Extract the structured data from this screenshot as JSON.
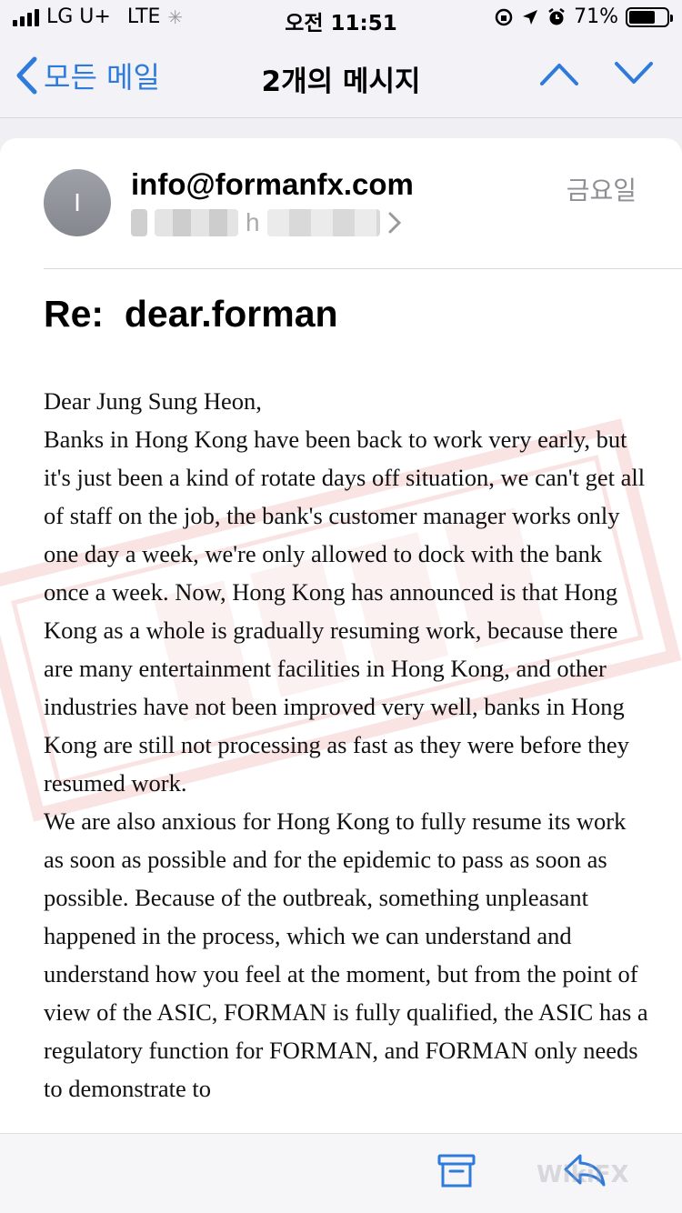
{
  "status_bar": {
    "carrier": "LG U+",
    "network": "LTE",
    "time": "오전 11:51",
    "battery_percent": "71%",
    "battery_level": 0.71
  },
  "nav": {
    "back_label": "모든 메일",
    "title": "2개의 메시지"
  },
  "email": {
    "avatar_initial": "I",
    "sender": "info@formanfx.com",
    "date": "금요일",
    "recipient_prefix": "h",
    "subject": "Re:  dear.forman",
    "body": [
      "Dear Jung Sung Heon,",
      "Banks in Hong Kong have been back to work very early, but it's just been a kind of rotate days off situation, we can't get all of staff on the job, the bank's customer manager works only one day a week, we're only allowed to dock with the bank once a week. Now, Hong Kong has announced is that Hong Kong as a whole is gradually resuming work, because there are many entertainment facilities in Hong Kong, and other industries have not been improved very well, banks in Hong Kong are still not processing as fast as they were before they resumed work.",
      "We are also anxious for Hong Kong to fully resume its work as soon as possible and for the epidemic to pass as soon as possible. Because of the outbreak, something unpleasant happened in the process, which we can understand and understand how you feel at the moment, but from the point of view of the ASIC, FORMAN is fully qualified, the ASIC has a regulatory function for FORMAN, and FORMAN only needs to demonstrate to"
    ]
  },
  "toolbar": {
    "watermark": "WikiFX"
  },
  "colors": {
    "accent": "#2f7bdc",
    "stamp": "#e05a5a"
  }
}
